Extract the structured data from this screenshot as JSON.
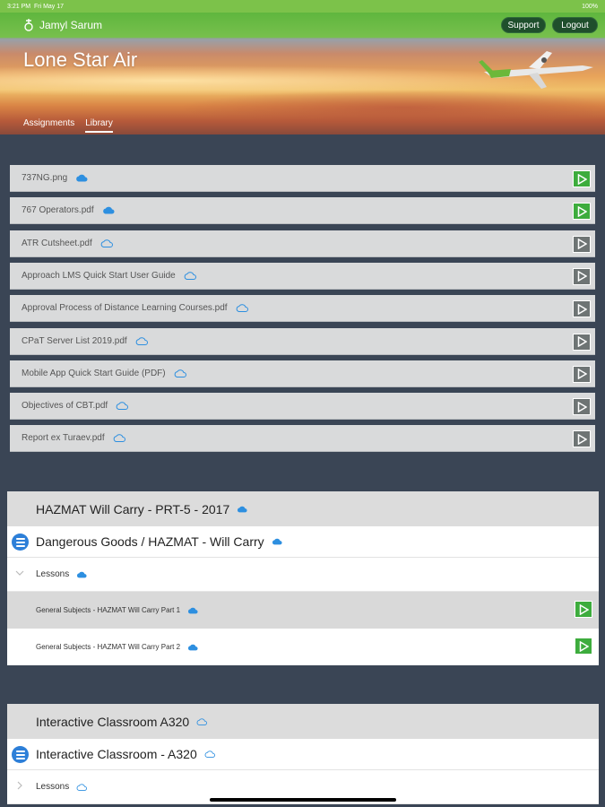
{
  "status_bar": {
    "time": "3:21 PM",
    "date": "Fri May 17",
    "battery": "100%"
  },
  "header": {
    "user_name": "Jamyl Sarum",
    "app_title": "Lone Star Air",
    "support_label": "Support",
    "logout_label": "Logout",
    "tabs": [
      {
        "label": "Assignments",
        "active": false
      },
      {
        "label": "Library",
        "active": true
      }
    ]
  },
  "library": {
    "items": [
      {
        "name": "737NG.png",
        "downloaded": true
      },
      {
        "name": "767 Operators.pdf",
        "downloaded": true
      },
      {
        "name": "ATR Cutsheet.pdf",
        "downloaded": false
      },
      {
        "name": "Approach LMS Quick Start User Guide",
        "downloaded": false
      },
      {
        "name": "Approval Process of Distance Learning Courses.pdf",
        "downloaded": false
      },
      {
        "name": "CPaT Server List 2019.pdf",
        "downloaded": false
      },
      {
        "name": "Mobile App Quick Start Guide (PDF)",
        "downloaded": false
      },
      {
        "name": "Objectives of CBT.pdf",
        "downloaded": false
      },
      {
        "name": "Report ex Turaev.pdf",
        "downloaded": false
      }
    ]
  },
  "courses": [
    {
      "title": "HAZMAT Will Carry - PRT-5 - 2017",
      "subtitle": "Dangerous Goods / HAZMAT - Will Carry",
      "lessons_label": "Lessons",
      "lessons": [
        {
          "name": "General Subjects - HAZMAT Will Carry Part 1"
        },
        {
          "name": "General Subjects - HAZMAT Will Carry Part 2"
        }
      ]
    },
    {
      "title": "Interactive Classroom A320",
      "subtitle": "Interactive Classroom - A320",
      "lessons_label": "Lessons"
    }
  ],
  "colors": {
    "play_active": "#3dac3d",
    "play_inactive": "#6e7474",
    "cloud": "#2d8fe0",
    "background": "#3a4555"
  },
  "icons": [
    "cloud-download-icon",
    "play-icon",
    "list-icon",
    "chevron-down-icon",
    "chevron-right-icon"
  ]
}
